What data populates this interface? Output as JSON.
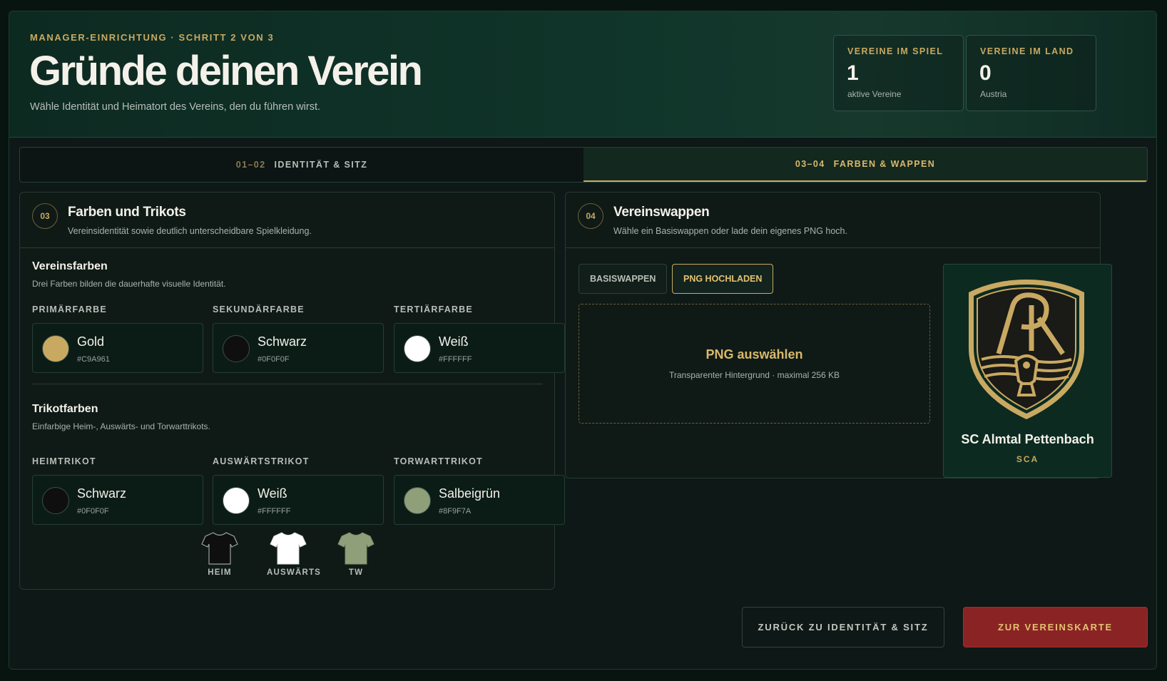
{
  "header": {
    "eyebrow": "MANAGER-EINRICHTUNG · SCHRITT 2 VON 3",
    "title": "Gründe deinen Verein",
    "subtitle": "Wähle Identität und Heimatort des Vereins, den du führen wirst.",
    "stats": [
      {
        "label": "VEREINE IM SPIEL",
        "value": "1",
        "sub": "aktive Vereine"
      },
      {
        "label": "VEREINE IM LAND",
        "value": "0",
        "sub": "Austria"
      }
    ]
  },
  "tabs": [
    {
      "num": "01–02",
      "label": "IDENTITÄT & SITZ",
      "active": false
    },
    {
      "num": "03–04",
      "label": "FARBEN & WAPPEN",
      "active": true
    }
  ],
  "colors_panel": {
    "badge": "03",
    "title": "Farben und Trikots",
    "desc": "Vereinsidentität sowie deutlich unterscheidbare Spielkleidung.",
    "club_colors": {
      "title": "Vereinsfarben",
      "desc": "Drei Farben bilden die dauerhafte visuelle Identität.",
      "items": [
        {
          "label": "PRIMÄRFARBE",
          "name": "Gold",
          "hex": "#C9A961"
        },
        {
          "label": "SEKUNDÄRFARBE",
          "name": "Schwarz",
          "hex": "#0F0F0F"
        },
        {
          "label": "TERTIÄRFARBE",
          "name": "Weiß",
          "hex": "#FFFFFF"
        }
      ]
    },
    "kit_colors": {
      "title": "Trikotfarben",
      "desc": "Einfarbige Heim-, Auswärts- und Torwarttrikots.",
      "items": [
        {
          "label": "HEIMTRIKOT",
          "name": "Schwarz",
          "hex": "#0F0F0F"
        },
        {
          "label": "AUSWÄRTSTRIKOT",
          "name": "Weiß",
          "hex": "#FFFFFF"
        },
        {
          "label": "TORWARTTRIKOT",
          "name": "Salbeigrün",
          "hex": "#8F9F7A"
        }
      ],
      "jerseys": [
        {
          "label": "HEIM",
          "color": "#0F0F0F"
        },
        {
          "label": "AUSWÄRTS",
          "color": "#FFFFFF"
        },
        {
          "label": "TW",
          "color": "#8F9F7A"
        }
      ]
    }
  },
  "crest_panel": {
    "badge": "04",
    "title": "Vereinswappen",
    "desc": "Wähle ein Basiswappen oder lade dein eigenes PNG hoch.",
    "toggle_base": "BASISWAPPEN",
    "toggle_upload": "PNG HOCHLADEN",
    "dropzone_title": "PNG auswählen",
    "dropzone_desc": "Transparenter Hintergrund · maximal 256 KB",
    "club_name": "SC Almtal Pettenbach",
    "club_abbr": "SCA"
  },
  "footer": {
    "back_label": "ZURÜCK ZU IDENTITÄT & SITZ",
    "next_label": "ZUR VEREINSKARTE"
  }
}
